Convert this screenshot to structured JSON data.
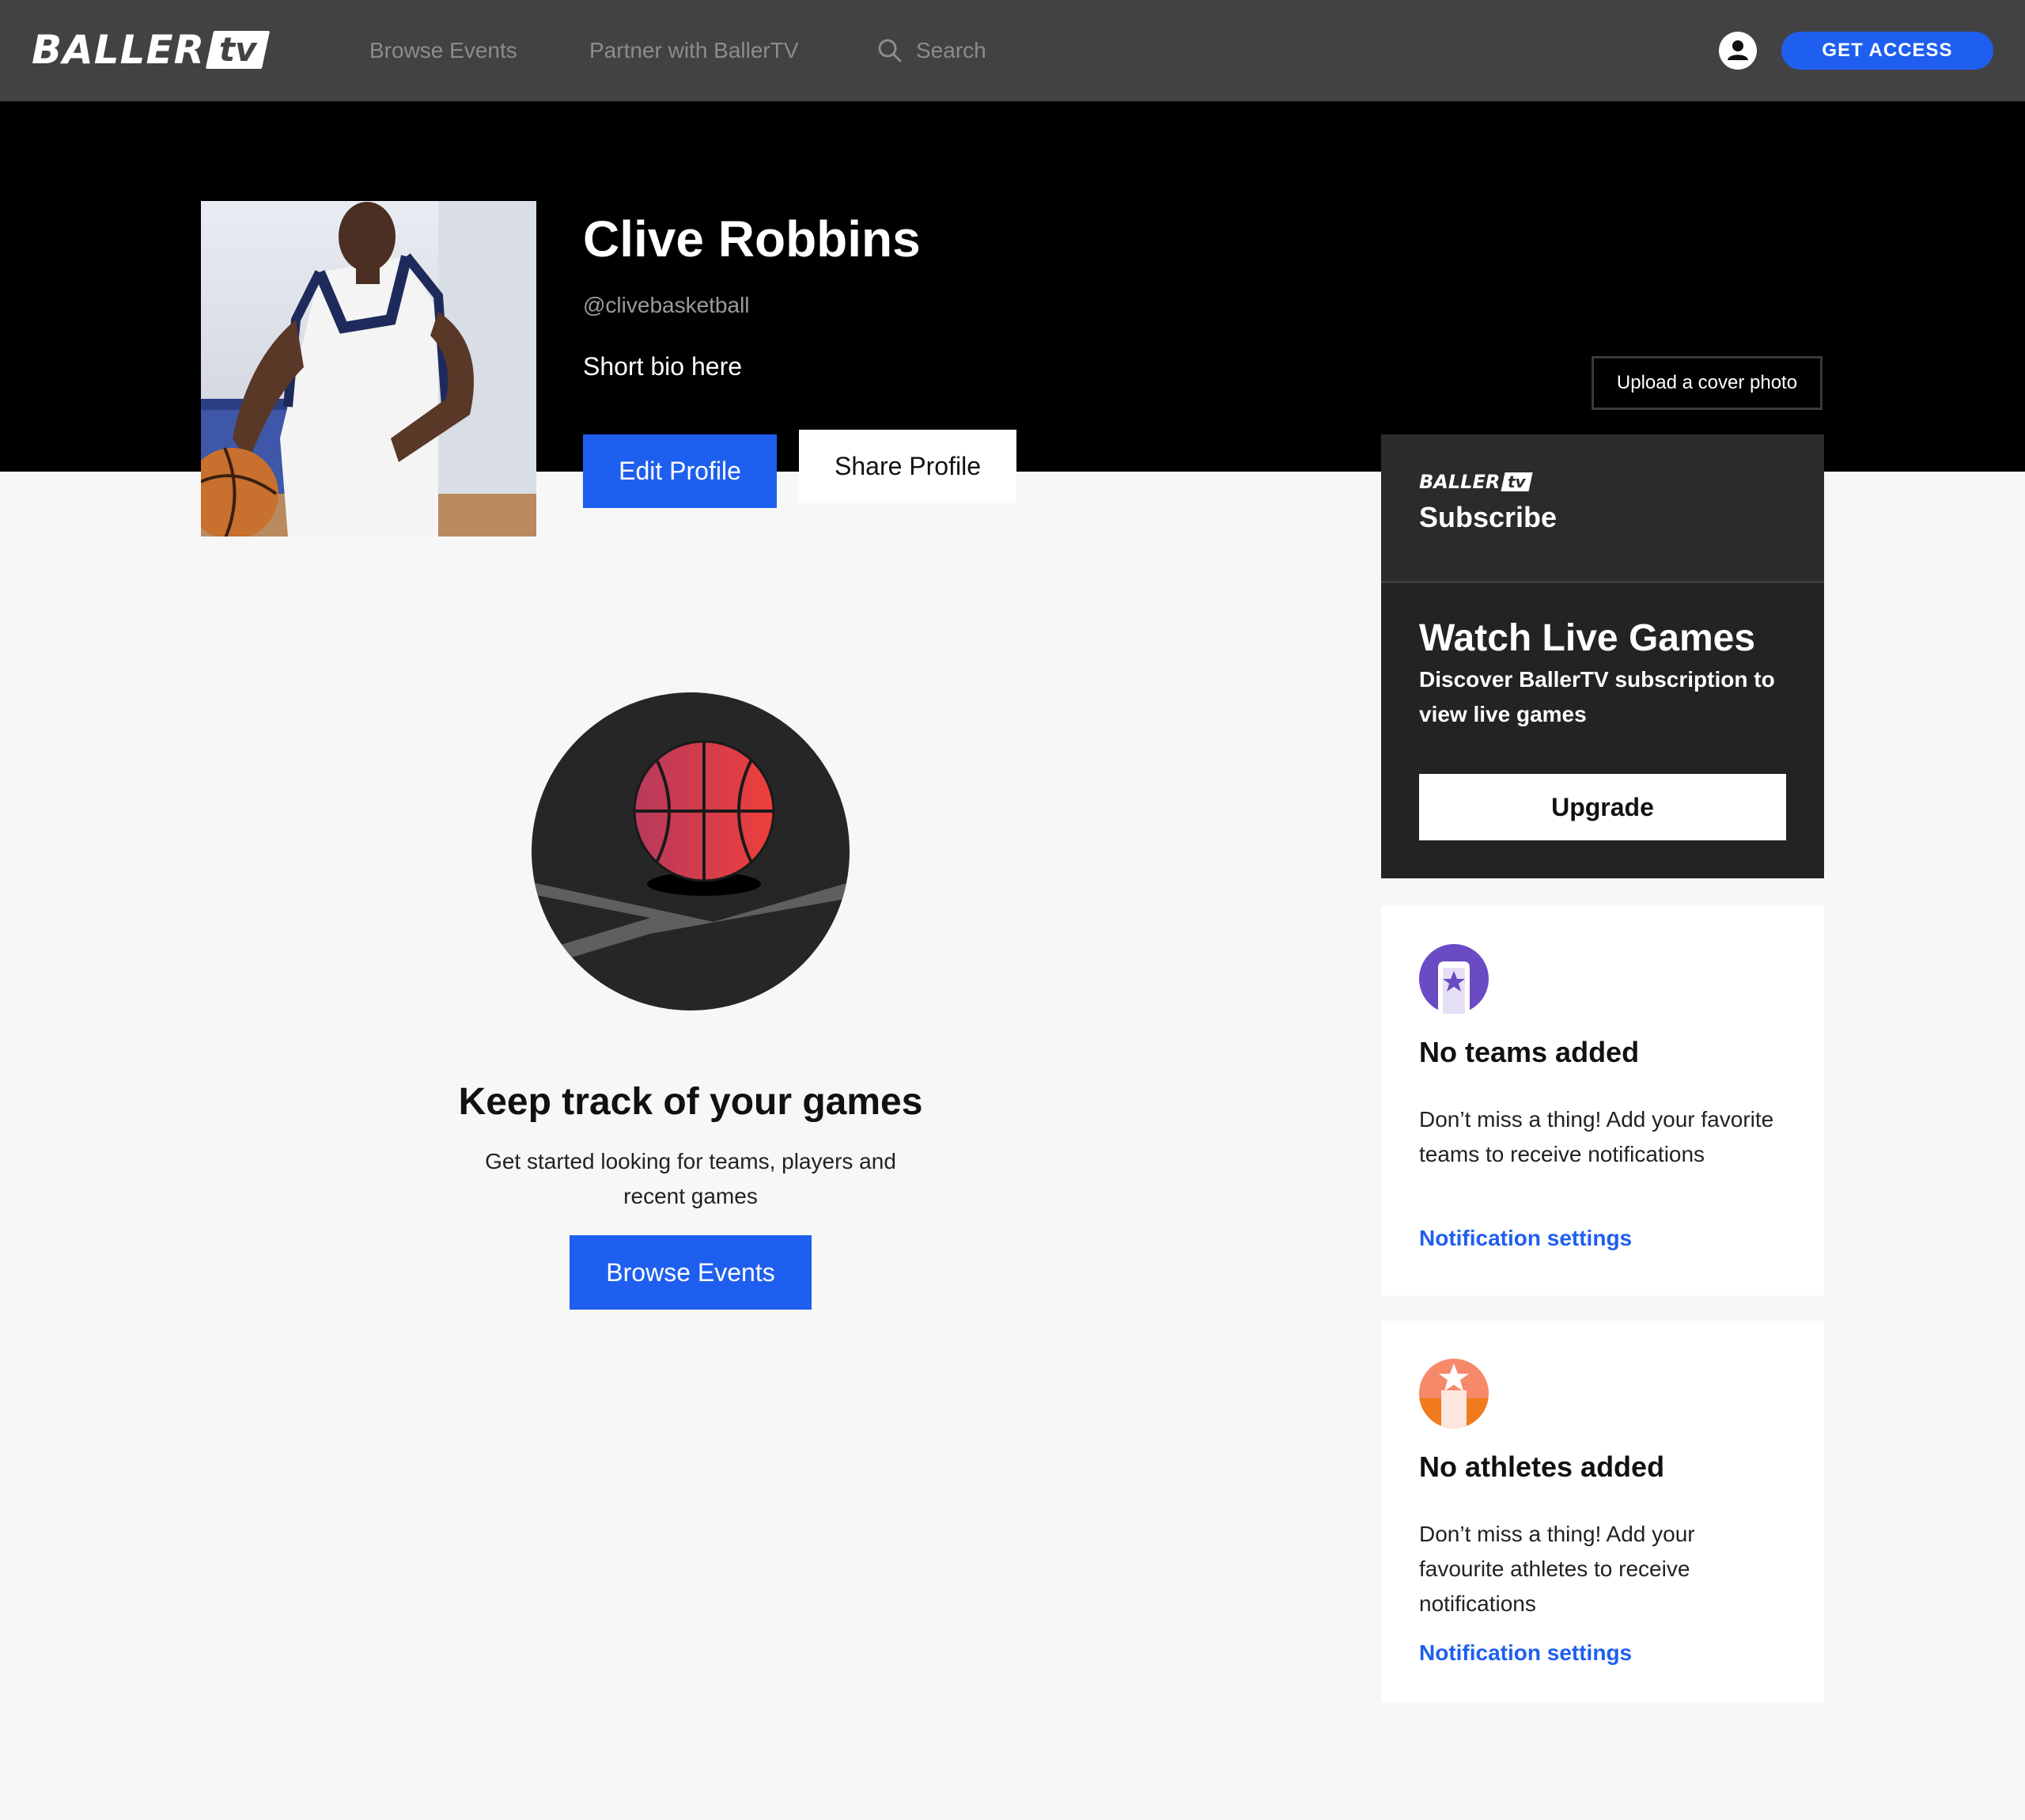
{
  "nav": {
    "logo_word": "BALLER",
    "logo_tv": "tv",
    "browse_events": "Browse Events",
    "partner": "Partner with BallerTV",
    "search": "Search",
    "get_access": "GET ACCESS"
  },
  "profile": {
    "name": "Clive Robbins",
    "handle": "@clivebasketball",
    "bio": "Short bio here",
    "edit_label": "Edit Profile",
    "share_label": "Share Profile",
    "cover_label": "Upload a cover photo"
  },
  "subscribe": {
    "logo_word": "BALLER",
    "logo_tv": "tv",
    "title": "Subscribe",
    "heading": "Watch Live Games",
    "description": "Discover BallerTV subscription to view live games",
    "upgrade_label": "Upgrade"
  },
  "empty_state": {
    "title": "Keep track of your games",
    "description": "Get started looking for teams, players and recent games",
    "button_label": "Browse Events"
  },
  "cards": {
    "teams": {
      "icon": "team-badge-icon",
      "title": "No teams added",
      "text": "Don’t miss a thing! Add your favorite teams to receive notifications",
      "link": "Notification settings"
    },
    "athletes": {
      "icon": "athlete-star-icon",
      "title": "No athletes added",
      "text": "Don’t miss a thing! Add your favourite athletes to receive notifications",
      "link": "Notification settings"
    }
  },
  "colors": {
    "accent": "#1f5fef",
    "navbar": "#424244",
    "hero": "#000000",
    "card_dark": "#232323",
    "teams_icon": "#6a4bc4",
    "athletes_icon": "#f07a3a"
  }
}
